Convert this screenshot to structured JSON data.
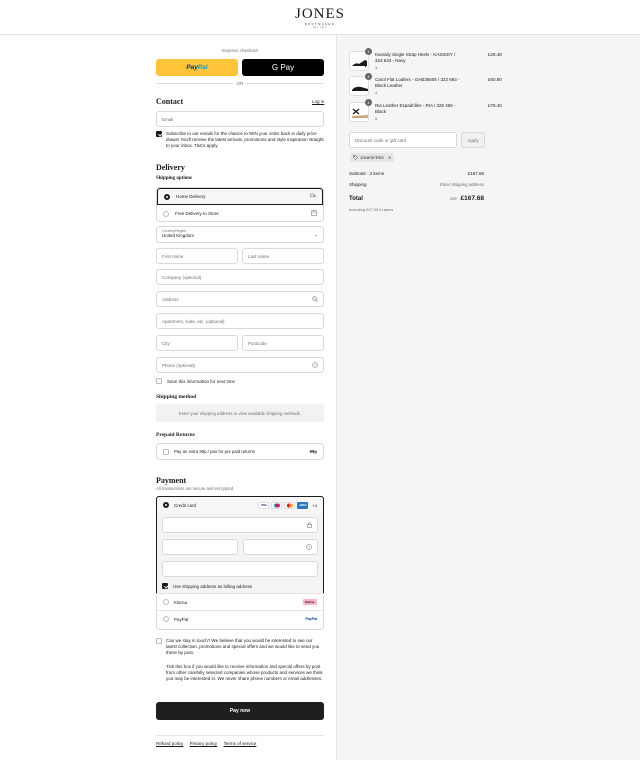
{
  "header": {
    "logo_main": "JONES",
    "logo_sub": "BOOTMAKER",
    "logo_tag": "EST. 1857"
  },
  "express": {
    "label": "Express checkout",
    "paypal_a": "Pay",
    "paypal_b": "Pal",
    "gpay": "G Pay",
    "or": "OR"
  },
  "contact": {
    "title": "Contact",
    "login": "Log in",
    "email_placeholder": "Email",
    "subscribe_text": "Subscribe to our emails for the chance to WIN your order back in daily prize draws! You'll receive the latest arrivals, promotions and style inspiration straight to your inbox. T&Cs apply."
  },
  "delivery": {
    "title": "Delivery",
    "shipping_options_title": "Shipping options",
    "option_home": "Home Delivery",
    "option_store": "Free Delivery to Store",
    "country_label": "Country/Region",
    "country_value": "United Kingdom",
    "first_name": "First name",
    "last_name": "Last name",
    "company": "Company (optional)",
    "address": "Address",
    "apartment": "Apartment, suite, etc. (optional)",
    "city": "City",
    "postcode": "Postcode",
    "phone": "Phone (optional)",
    "save_info": "Save this information for next time"
  },
  "shipping_method": {
    "title": "Shipping method",
    "notice": "Enter your shipping address to view available shipping methods."
  },
  "prepaid": {
    "title": "Prepaid Returns",
    "label": "Pay an extra 99p / pair for pre paid returns",
    "price": "99p"
  },
  "payment": {
    "title": "Payment",
    "subtitle": "All transactions are secure and encrypted.",
    "credit_card": "Credit card",
    "more_cards": "+4",
    "billing_same": "Use shipping address as billing address",
    "klarna": "Klarna",
    "klarna_badge": "Klarna.",
    "paypal": "PayPal",
    "paypal_badge": "PayPal"
  },
  "consent": {
    "text1": "Can we stay in touch? We believe that you would be interested to see our latest collection, promotions and special offers and we would like to send you these by post.",
    "text2": "Tick this box if you would like to receive information and special offers by post from other carefully selected companies whose products and services we think you may be interested in. We never share phone numbers or email addresses."
  },
  "pay_now": "Pay now",
  "footer": {
    "refund": "Refund policy",
    "privacy": "Privacy policy",
    "terms": "Terms of service"
  },
  "summary": {
    "items": [
      {
        "qty": "1",
        "name": "Kassidy Single Strap Heels - KASSIDY / 323 633 - Navy",
        "size": "3",
        "price": "£28.48"
      },
      {
        "qty": "1",
        "name": "Carol Flat Loafers - OAB36505 / 322 693 - Black Leather",
        "size": "4",
        "price": "£60.80"
      },
      {
        "qty": "1",
        "name": "Ria Leather Espadrilles - RIA / 325 465 - Black",
        "size": "5",
        "price": "£78.40"
      }
    ],
    "discount_placeholder": "Discount code or gift card",
    "apply": "Apply",
    "discount_tag": "JONESFREE",
    "subtotal_label": "Subtotal · 3 items",
    "subtotal_value": "£167.68",
    "shipping_label": "Shipping",
    "shipping_value": "Enter shipping address",
    "total_label": "Total",
    "currency": "GBP",
    "total_value": "£167.68",
    "tax_note": "Including £27.95 in taxes"
  }
}
